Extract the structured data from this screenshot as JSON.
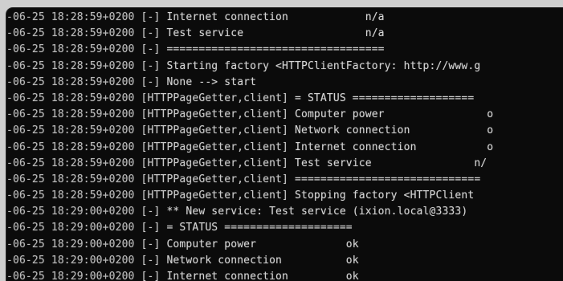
{
  "terminal": {
    "lines": [
      {
        "ts": "-06-25 18:28:59+0200",
        "tag": "[-]",
        "msg": "Internet connection            n/a"
      },
      {
        "ts": "-06-25 18:28:59+0200",
        "tag": "[-]",
        "msg": "Test service                   n/a"
      },
      {
        "ts": "-06-25 18:28:59+0200",
        "tag": "[-]",
        "msg": "=================================="
      },
      {
        "ts": "-06-25 18:28:59+0200",
        "tag": "[-]",
        "msg": "Starting factory <HTTPClientFactory: http://www.g"
      },
      {
        "ts": "-06-25 18:28:59+0200",
        "tag": "[-]",
        "msg": "None --> start"
      },
      {
        "ts": "-06-25 18:28:59+0200",
        "tag": "[HTTPPageGetter,client]",
        "msg": "= STATUS ==================="
      },
      {
        "ts": "-06-25 18:28:59+0200",
        "tag": "[HTTPPageGetter,client]",
        "msg": "Computer power                o"
      },
      {
        "ts": "-06-25 18:28:59+0200",
        "tag": "[HTTPPageGetter,client]",
        "msg": "Network connection            o"
      },
      {
        "ts": "-06-25 18:28:59+0200",
        "tag": "[HTTPPageGetter,client]",
        "msg": "Internet connection           o"
      },
      {
        "ts": "-06-25 18:28:59+0200",
        "tag": "[HTTPPageGetter,client]",
        "msg": "Test service                n/"
      },
      {
        "ts": "-06-25 18:28:59+0200",
        "tag": "[HTTPPageGetter,client]",
        "msg": "============================="
      },
      {
        "ts": "-06-25 18:28:59+0200",
        "tag": "[HTTPPageGetter,client]",
        "msg": "Stopping factory <HTTPClient"
      },
      {
        "ts": "-06-25 18:29:00+0200",
        "tag": "[-]",
        "msg": "** New service: Test service (ixion.local@3333)"
      },
      {
        "ts": "-06-25 18:29:00+0200",
        "tag": "[-]",
        "msg": "= STATUS ===================="
      },
      {
        "ts": "-06-25 18:29:00+0200",
        "tag": "[-]",
        "msg": "Computer power              ok"
      },
      {
        "ts": "-06-25 18:29:00+0200",
        "tag": "[-]",
        "msg": "Network connection          ok"
      },
      {
        "ts": "-06-25 18:29:00+0200",
        "tag": "[-]",
        "msg": "Internet connection         ok"
      }
    ]
  }
}
